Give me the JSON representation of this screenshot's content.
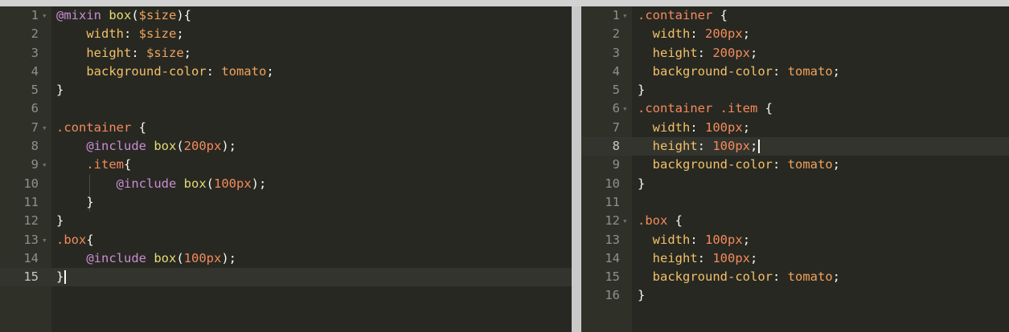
{
  "left_editor": {
    "active_line": 15,
    "lines": [
      {
        "n": "1",
        "fold": true,
        "tokens": [
          [
            "kw",
            "@mixin "
          ],
          [
            "fn",
            "box"
          ],
          [
            "punc",
            "("
          ],
          [
            "var",
            "$size"
          ],
          [
            "punc",
            "){"
          ]
        ]
      },
      {
        "n": "2",
        "fold": false,
        "tokens": [
          [
            "ws",
            "    "
          ],
          [
            "prop",
            "width"
          ],
          [
            "punc",
            ": "
          ],
          [
            "var",
            "$size"
          ],
          [
            "punc",
            ";"
          ]
        ]
      },
      {
        "n": "3",
        "fold": false,
        "tokens": [
          [
            "ws",
            "    "
          ],
          [
            "prop",
            "height"
          ],
          [
            "punc",
            ": "
          ],
          [
            "var",
            "$size"
          ],
          [
            "punc",
            ";"
          ]
        ]
      },
      {
        "n": "4",
        "fold": false,
        "tokens": [
          [
            "ws",
            "    "
          ],
          [
            "prop",
            "background-color"
          ],
          [
            "punc",
            ": "
          ],
          [
            "val",
            "tomato"
          ],
          [
            "punc",
            ";"
          ]
        ]
      },
      {
        "n": "5",
        "fold": false,
        "tokens": [
          [
            "punc",
            "}"
          ]
        ]
      },
      {
        "n": "6",
        "fold": false,
        "tokens": []
      },
      {
        "n": "7",
        "fold": true,
        "tokens": [
          [
            "sel",
            ".container"
          ],
          [
            "punc",
            " {"
          ]
        ]
      },
      {
        "n": "8",
        "fold": false,
        "tokens": [
          [
            "ws",
            "    "
          ],
          [
            "kw",
            "@include "
          ],
          [
            "fn",
            "box"
          ],
          [
            "punc",
            "("
          ],
          [
            "num",
            "200"
          ],
          [
            "unit",
            "px"
          ],
          [
            "punc",
            ");"
          ]
        ]
      },
      {
        "n": "9",
        "fold": true,
        "tokens": [
          [
            "ws",
            "    "
          ],
          [
            "sel",
            ".item"
          ],
          [
            "punc",
            "{"
          ]
        ]
      },
      {
        "n": "10",
        "fold": false,
        "tokens": [
          [
            "ws",
            "        "
          ],
          [
            "kw",
            "@include "
          ],
          [
            "fn",
            "box"
          ],
          [
            "punc",
            "("
          ],
          [
            "num",
            "100"
          ],
          [
            "unit",
            "px"
          ],
          [
            "punc",
            ");"
          ]
        ]
      },
      {
        "n": "11",
        "fold": false,
        "tokens": [
          [
            "ws",
            "    "
          ],
          [
            "punc",
            "}"
          ]
        ]
      },
      {
        "n": "12",
        "fold": false,
        "tokens": [
          [
            "punc",
            "}"
          ]
        ]
      },
      {
        "n": "13",
        "fold": true,
        "tokens": [
          [
            "sel",
            ".box"
          ],
          [
            "punc",
            "{"
          ]
        ]
      },
      {
        "n": "14",
        "fold": false,
        "tokens": [
          [
            "ws",
            "    "
          ],
          [
            "kw",
            "@include "
          ],
          [
            "fn",
            "box"
          ],
          [
            "punc",
            "("
          ],
          [
            "num",
            "100"
          ],
          [
            "unit",
            "px"
          ],
          [
            "punc",
            ");"
          ]
        ]
      },
      {
        "n": "15",
        "fold": false,
        "tokens": [
          [
            "punc",
            "}"
          ]
        ]
      }
    ]
  },
  "right_editor": {
    "active_line": 8,
    "lines": [
      {
        "n": "1",
        "fold": true,
        "tokens": [
          [
            "sel",
            ".container"
          ],
          [
            "punc",
            " {"
          ]
        ]
      },
      {
        "n": "2",
        "fold": false,
        "tokens": [
          [
            "ws",
            "  "
          ],
          [
            "prop",
            "width"
          ],
          [
            "punc",
            ": "
          ],
          [
            "num",
            "200"
          ],
          [
            "unit",
            "px"
          ],
          [
            "punc",
            ";"
          ]
        ]
      },
      {
        "n": "3",
        "fold": false,
        "tokens": [
          [
            "ws",
            "  "
          ],
          [
            "prop",
            "height"
          ],
          [
            "punc",
            ": "
          ],
          [
            "num",
            "200"
          ],
          [
            "unit",
            "px"
          ],
          [
            "punc",
            ";"
          ]
        ]
      },
      {
        "n": "4",
        "fold": false,
        "tokens": [
          [
            "ws",
            "  "
          ],
          [
            "prop",
            "background-color"
          ],
          [
            "punc",
            ": "
          ],
          [
            "val",
            "tomato"
          ],
          [
            "punc",
            ";"
          ]
        ]
      },
      {
        "n": "5",
        "fold": false,
        "tokens": [
          [
            "punc",
            "}"
          ]
        ]
      },
      {
        "n": "6",
        "fold": true,
        "tokens": [
          [
            "sel",
            ".container .item"
          ],
          [
            "punc",
            " {"
          ]
        ]
      },
      {
        "n": "7",
        "fold": false,
        "tokens": [
          [
            "ws",
            "  "
          ],
          [
            "prop",
            "width"
          ],
          [
            "punc",
            ": "
          ],
          [
            "num",
            "100"
          ],
          [
            "unit",
            "px"
          ],
          [
            "punc",
            ";"
          ]
        ]
      },
      {
        "n": "8",
        "fold": false,
        "tokens": [
          [
            "ws",
            "  "
          ],
          [
            "prop",
            "height"
          ],
          [
            "punc",
            ": "
          ],
          [
            "num",
            "100"
          ],
          [
            "unit",
            "px"
          ],
          [
            "punc",
            ";"
          ]
        ]
      },
      {
        "n": "9",
        "fold": false,
        "tokens": [
          [
            "ws",
            "  "
          ],
          [
            "prop",
            "background-color"
          ],
          [
            "punc",
            ": "
          ],
          [
            "val",
            "tomato"
          ],
          [
            "punc",
            ";"
          ]
        ]
      },
      {
        "n": "10",
        "fold": false,
        "tokens": [
          [
            "punc",
            "}"
          ]
        ]
      },
      {
        "n": "11",
        "fold": false,
        "tokens": []
      },
      {
        "n": "12",
        "fold": true,
        "tokens": [
          [
            "sel",
            ".box"
          ],
          [
            "punc",
            " {"
          ]
        ]
      },
      {
        "n": "13",
        "fold": false,
        "tokens": [
          [
            "ws",
            "  "
          ],
          [
            "prop",
            "width"
          ],
          [
            "punc",
            ": "
          ],
          [
            "num",
            "100"
          ],
          [
            "unit",
            "px"
          ],
          [
            "punc",
            ";"
          ]
        ]
      },
      {
        "n": "14",
        "fold": false,
        "tokens": [
          [
            "ws",
            "  "
          ],
          [
            "prop",
            "height"
          ],
          [
            "punc",
            ": "
          ],
          [
            "num",
            "100"
          ],
          [
            "unit",
            "px"
          ],
          [
            "punc",
            ";"
          ]
        ]
      },
      {
        "n": "15",
        "fold": false,
        "tokens": [
          [
            "ws",
            "  "
          ],
          [
            "prop",
            "background-color"
          ],
          [
            "punc",
            ": "
          ],
          [
            "val",
            "tomato"
          ],
          [
            "punc",
            ";"
          ]
        ]
      },
      {
        "n": "16",
        "fold": false,
        "tokens": [
          [
            "punc",
            "}"
          ]
        ]
      }
    ]
  },
  "fold_icon": "chevron-down-icon",
  "colors": {
    "editor_bg": "#272822",
    "gutter_bg": "#2f3129",
    "active_line_bg": "#33342e",
    "keyword": "#c98dd2",
    "function": "#e6db74",
    "variable": "#f0a35c",
    "property": "#f2c068",
    "number": "#f58a5c",
    "value": "#f2a25c"
  }
}
